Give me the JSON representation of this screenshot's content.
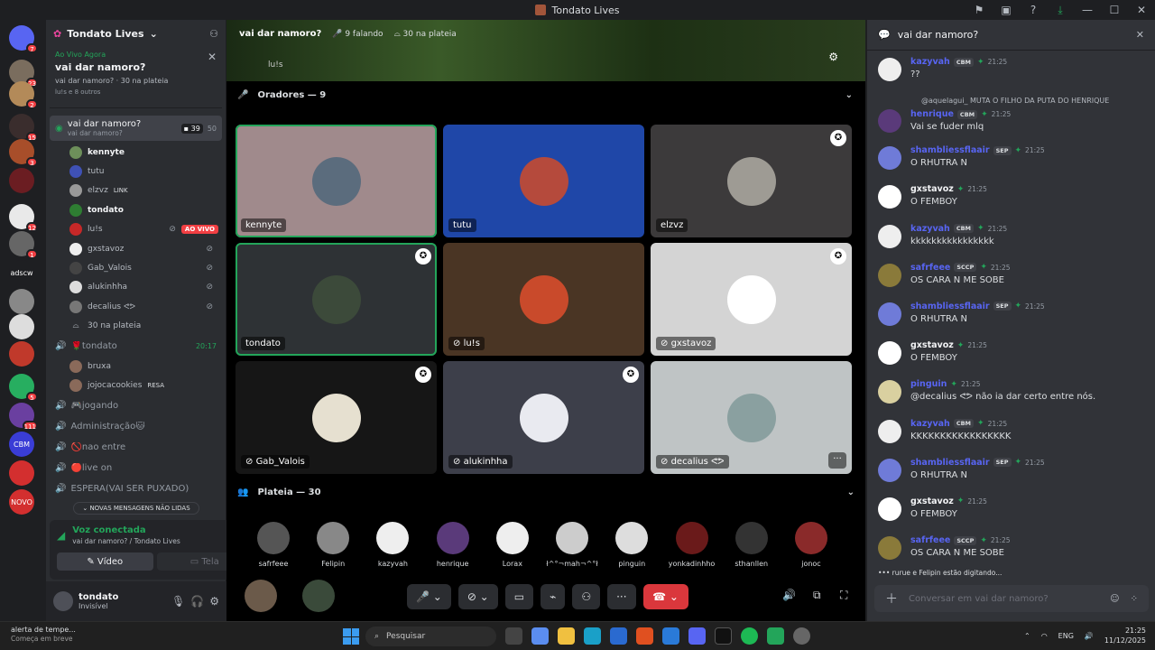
{
  "window": {
    "title": "Tondato Lives"
  },
  "rail": {
    "servers": [
      {
        "name": "discord-home",
        "badge": "7",
        "color": "#5865f2",
        "label": ""
      },
      {
        "name": "server-1",
        "badge": "23",
        "color": "#7a6d5e",
        "label": ""
      },
      {
        "name": "server-2",
        "badge": "2",
        "color": "#b38a59",
        "label": ""
      },
      {
        "name": "server-3",
        "badge": "15",
        "color": "#3a2d2d",
        "label": ""
      },
      {
        "name": "server-4",
        "badge": "3",
        "color": "#a84e2a",
        "label": ""
      },
      {
        "name": "server-5",
        "badge": "",
        "color": "#6b1d22",
        "label": ""
      },
      {
        "name": "server-6",
        "badge": "12",
        "color": "#e9e9e9",
        "label": ""
      },
      {
        "name": "server-7",
        "badge": "1",
        "color": "#666",
        "label": ""
      },
      {
        "name": "server-adscw",
        "badge": "",
        "color": "#1e1f22",
        "label": "adscw"
      },
      {
        "name": "server-8",
        "badge": "",
        "color": "#888",
        "label": ""
      },
      {
        "name": "server-tondato",
        "badge": "",
        "color": "#ddd",
        "label": ""
      },
      {
        "name": "server-9",
        "badge": "",
        "color": "#c0392b",
        "label": ""
      },
      {
        "name": "server-10",
        "badge": "5",
        "color": "#27ae60",
        "label": ""
      },
      {
        "name": "server-11",
        "badge": "111",
        "color": "#6a3fa0",
        "label": ""
      },
      {
        "name": "server-cbm",
        "badge": "",
        "color": "#3a3dd6",
        "label": "CBM"
      },
      {
        "name": "server-master",
        "badge": "",
        "color": "#d32f2f",
        "label": ""
      },
      {
        "name": "server-novo",
        "badge": "",
        "color": "#d32f2f",
        "label": "NOVO"
      }
    ]
  },
  "sidebar": {
    "guild_name": "Tondato Lives",
    "live_card": {
      "status": "Ao Vivo Agora",
      "title": "vai dar namoro?",
      "info": "vai dar namoro?  ·  30 na plateia",
      "others": "lu!s e 8 outros"
    },
    "active_channel": {
      "name": "vai dar namoro?",
      "sub": "vai dar namoro?",
      "video_count": "39",
      "limit": "50"
    },
    "members": [
      {
        "name": "kennyte",
        "bold": true,
        "extra": "",
        "live": false,
        "muted": false,
        "color": "#6d8f5a"
      },
      {
        "name": "tutu",
        "bold": false,
        "extra": "",
        "live": false,
        "muted": false,
        "color": "#3f51b5"
      },
      {
        "name": "elzvz",
        "bold": false,
        "extra": "LINK",
        "live": false,
        "muted": false,
        "color": "#999"
      },
      {
        "name": "tondato",
        "bold": true,
        "extra": "",
        "live": false,
        "muted": false,
        "color": "#2e7d32"
      },
      {
        "name": "lu!s",
        "bold": false,
        "extra": "",
        "live": true,
        "muted": true,
        "color": "#c62828"
      },
      {
        "name": "gxstavoz",
        "bold": false,
        "extra": "",
        "live": false,
        "muted": true,
        "color": "#eee"
      },
      {
        "name": "Gab_Valois",
        "bold": false,
        "extra": "",
        "live": false,
        "muted": true,
        "color": "#444"
      },
      {
        "name": "alukinhha",
        "bold": false,
        "extra": "",
        "live": false,
        "muted": true,
        "color": "#ddd"
      },
      {
        "name": "decalius ᕙᕗ",
        "bold": false,
        "extra": "",
        "live": false,
        "muted": true,
        "color": "#777"
      }
    ],
    "live_label": "AO VIVO",
    "audience_line": "30 na plateia",
    "channels": [
      {
        "name": "🌹tondato",
        "time": "20:17"
      },
      {
        "name": "bruxa",
        "member": true
      },
      {
        "name": "jojocacookies",
        "member": true,
        "extra": "RESA"
      },
      {
        "name": "🎮jogando"
      },
      {
        "name": "Administração🐱"
      },
      {
        "name": "🚫nao entre"
      },
      {
        "name": "🔴live on"
      },
      {
        "name": "ESPERA(VAI SER PUXADO)"
      }
    ],
    "new_messages": "NOVAS MENSAGENS NÃO LIDAS",
    "voice": {
      "status": "Voz conectada",
      "location": "vai dar namoro? / Tondato Lives",
      "video_label": "Vídeo",
      "screen_label": "Tela"
    },
    "user": {
      "name": "tondato",
      "status": "Invisível"
    }
  },
  "stage": {
    "title": "vai dar namoro?",
    "talking": "9 falando",
    "audience": "30 na plateia",
    "stream_owner": "lu!s",
    "speakers_header": "Oradores — 9",
    "tiles": [
      {
        "name": "kennyte",
        "bg": "#a08a8c",
        "avatar": "#5b6c7d",
        "speaking": true,
        "mod": false,
        "muted": false
      },
      {
        "name": "tutu",
        "bg": "#1f47a8",
        "avatar": "#b54a3c",
        "speaking": false,
        "mod": false,
        "muted": false
      },
      {
        "name": "elzvz",
        "bg": "#3c3a3b",
        "avatar": "#9e9b94",
        "speaking": false,
        "mod": true,
        "muted": false
      },
      {
        "name": "tondato",
        "bg": "#2e3235",
        "avatar": "#3c4a3a",
        "speaking": true,
        "mod": true,
        "muted": false
      },
      {
        "name": "lu!s",
        "bg": "#4a3524",
        "avatar": "#c94a2b",
        "speaking": false,
        "mod": false,
        "muted": true
      },
      {
        "name": "gxstavoz",
        "bg": "#d4d4d4",
        "avatar": "#ffffff",
        "speaking": false,
        "mod": true,
        "muted": true
      },
      {
        "name": "Gab_Valois",
        "bg": "#161616",
        "avatar": "#e6e0d0",
        "speaking": false,
        "mod": true,
        "muted": true
      },
      {
        "name": "alukinhha",
        "bg": "#3d3f4a",
        "avatar": "#e9eaf0",
        "speaking": false,
        "mod": true,
        "muted": true
      },
      {
        "name": "decalius ᕙᕗ",
        "bg": "#bfc4c5",
        "avatar": "#8aa0a0",
        "speaking": false,
        "mod": false,
        "muted": true,
        "more": true
      }
    ],
    "audience_header": "Plateia — 30",
    "audience_members": [
      {
        "name": "safrfeee",
        "color": "#555"
      },
      {
        "name": "Felipin",
        "color": "#888"
      },
      {
        "name": "kazyvah",
        "color": "#eee"
      },
      {
        "name": "henrique",
        "color": "#5a3a7a"
      },
      {
        "name": "Lorax",
        "color": "#eee"
      },
      {
        "name": "ł^°¬mah¬^°ł",
        "color": "#ccc"
      },
      {
        "name": "pinguin",
        "color": "#ddd"
      },
      {
        "name": "yonkadinhho",
        "color": "#6a1a1a"
      },
      {
        "name": "sthanllen",
        "color": "#333"
      },
      {
        "name": "jonoc",
        "color": "#8a2a2a"
      }
    ],
    "controls": {
      "hangup": "✆"
    }
  },
  "chat": {
    "title": "vai dar namoro?",
    "messages": [
      {
        "user": "kazyvah",
        "badge": "CBM",
        "time": "21:25",
        "text": "??",
        "color": "#5865f2",
        "avatar": "#eeeeee"
      },
      {
        "user": "henrique",
        "badge": "CBM",
        "time": "21:25",
        "text": "Vai se fuder mlq",
        "color": "#5865f2",
        "avatar": "#5a3a7a",
        "reply": "@aquelagui_ MUTA O FILHO DA PUTA DO HENRIQUE"
      },
      {
        "user": "shambliessflaair",
        "badge": "SEP",
        "time": "21:25",
        "text": "O RHUTRA N",
        "color": "#5865f2",
        "avatar": "#6f7bd8"
      },
      {
        "user": "gxstavoz",
        "badge": "",
        "time": "21:25",
        "text": "O FEMBOY",
        "color": "#f2f3f5",
        "avatar": "#ffffff"
      },
      {
        "user": "kazyvah",
        "badge": "CBM",
        "time": "21:25",
        "text": "kkkkkkkkkkkkkkkk",
        "color": "#5865f2",
        "avatar": "#eeeeee"
      },
      {
        "user": "safrfeee",
        "badge": "SCCP",
        "time": "21:25",
        "text": "OS CARA N ME SOBE",
        "color": "#5865f2",
        "avatar": "#8a7a3a"
      },
      {
        "user": "shambliessflaair",
        "badge": "SEP",
        "time": "21:25",
        "text": "O RHUTRA N",
        "color": "#5865f2",
        "avatar": "#6f7bd8"
      },
      {
        "user": "gxstavoz",
        "badge": "",
        "time": "21:25",
        "text": "O FEMBOY",
        "color": "#f2f3f5",
        "avatar": "#ffffff"
      },
      {
        "user": "pinguin",
        "badge": "",
        "time": "21:25",
        "text": "@decalius ᕙᕗ não ia dar certo entre nós.",
        "color": "#5865f2",
        "avatar": "#d9d0a0"
      },
      {
        "user": "kazyvah",
        "badge": "CBM",
        "time": "21:25",
        "text": "KKKKKKKKKKKKKKKKK",
        "color": "#5865f2",
        "avatar": "#eeeeee"
      },
      {
        "user": "shambliessflaair",
        "badge": "SEP",
        "time": "21:25",
        "text": "O RHUTRA N",
        "color": "#5865f2",
        "avatar": "#6f7bd8"
      },
      {
        "user": "gxstavoz",
        "badge": "",
        "time": "21:25",
        "text": "O FEMBOY",
        "color": "#f2f3f5",
        "avatar": "#ffffff"
      },
      {
        "user": "safrfeee",
        "badge": "SCCP",
        "time": "21:25",
        "text": "OS CARA N ME SOBE",
        "color": "#5865f2",
        "avatar": "#8a7a3a"
      }
    ],
    "typing": "rurue e Felipin estão digitando...",
    "input_placeholder": "Conversar em vai dar namoro?"
  },
  "taskbar": {
    "weather_title": "alerta de tempe...",
    "weather_sub": "Começa em breve",
    "search_placeholder": "Pesquisar",
    "lang": "ENG",
    "time": "21:25",
    "date": "11/12/2025"
  }
}
